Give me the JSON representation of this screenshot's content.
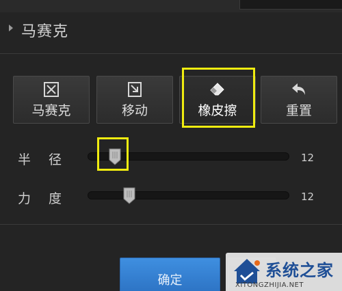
{
  "panel": {
    "section_title": "马赛克"
  },
  "tools": [
    {
      "label": "马赛克",
      "icon": "mosaic-icon"
    },
    {
      "label": "移动",
      "icon": "move-icon"
    },
    {
      "label": "橡皮擦",
      "icon": "eraser-icon",
      "highlighted": true
    },
    {
      "label": "重置",
      "icon": "undo-arrow-icon"
    }
  ],
  "sliders": {
    "radius": {
      "label": "半径",
      "value": "12",
      "level": 0.12
    },
    "strength": {
      "label": "力度",
      "value": "12",
      "level": 0.22
    }
  },
  "footer": {
    "confirm_label": "确定",
    "cancel_label": ""
  },
  "watermark": {
    "name": "系统之家",
    "url": "XITONGZHIJIA.NET"
  },
  "colors": {
    "background": "#242424",
    "highlight": "#f0ec10",
    "confirm": "#2f7bd0"
  }
}
